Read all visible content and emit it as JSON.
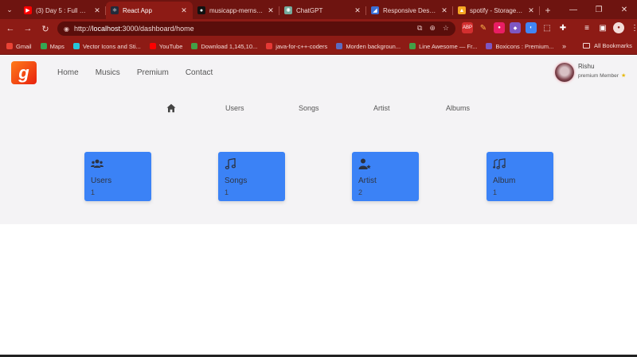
{
  "browser": {
    "tabs": [
      {
        "title": "(3) Day 5 : Full Stack",
        "fav_color": "#ff0000",
        "fav_glyph": "▶",
        "active": false
      },
      {
        "title": "React App",
        "fav_color": "#222a3a",
        "fav_glyph": "⚛",
        "active": true
      },
      {
        "title": "musicapp-mernstack",
        "fav_color": "#111111",
        "fav_glyph": "●",
        "active": false
      },
      {
        "title": "ChatGPT",
        "fav_color": "#74aa9c",
        "fav_glyph": "✺",
        "active": false
      },
      {
        "title": "Responsive Design -",
        "fav_color": "#3b6fd6",
        "fav_glyph": "◢",
        "active": false
      },
      {
        "title": "spotify - Storage - Fi",
        "fav_color": "#f5a623",
        "fav_glyph": "▲",
        "active": false
      }
    ],
    "url_prefix": "http://",
    "url_host": "localhost",
    "url_path": ":3000/dashboard/home",
    "bookmarks": [
      {
        "label": "Gmail",
        "color": "#ea4335"
      },
      {
        "label": "Maps",
        "color": "#34a853"
      },
      {
        "label": "Vector Icons and Sti...",
        "color": "#26c6da"
      },
      {
        "label": "YouTube",
        "color": "#ff0000"
      },
      {
        "label": "Download 1,145,10...",
        "color": "#43a047"
      },
      {
        "label": "java-for-c++-coders",
        "color": "#e53935"
      },
      {
        "label": "Morden backgroun...",
        "color": "#5c6bc0"
      },
      {
        "label": "Line Awesome — Fr...",
        "color": "#43a047"
      },
      {
        "label": "Boxicons : Premium...",
        "color": "#7e57c2"
      }
    ],
    "all_bookmarks": "All Bookmarks"
  },
  "header": {
    "logo_letter": "g",
    "nav": [
      "Home",
      "Musics",
      "Premium",
      "Contact"
    ],
    "user_name": "Rishu",
    "user_status": "premium Member"
  },
  "subnav": [
    "Users",
    "Songs",
    "Artist",
    "Albums"
  ],
  "cards": [
    {
      "title": "Users",
      "count": "1",
      "icon": "users-icon"
    },
    {
      "title": "Songs",
      "count": "1",
      "icon": "music-note-icon"
    },
    {
      "title": "Artist",
      "count": "2",
      "icon": "artist-icon"
    },
    {
      "title": "Album",
      "count": "1",
      "icon": "album-icon"
    }
  ],
  "colors": {
    "chrome": "#8d1b15",
    "card": "#3b82f6",
    "page_bg": "#f4f3f5"
  }
}
